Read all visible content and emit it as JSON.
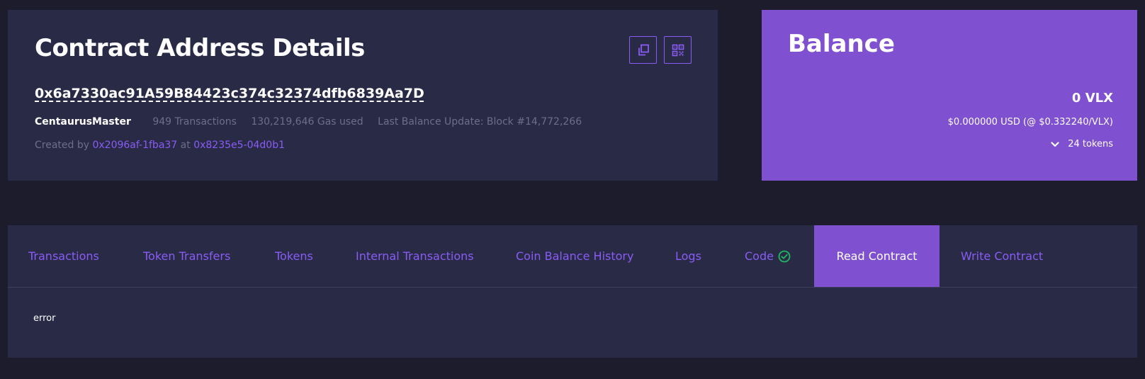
{
  "details": {
    "title": "Contract Address Details",
    "address": "0x6a7330ac91A59B84423c374c32374dfb6839Aa7D",
    "name": "CentaurusMaster",
    "transactions": "949 Transactions",
    "gas_used": "130,219,646 Gas used",
    "last_balance_update": "Last Balance Update: Block #14,772,266",
    "created_by_label": "Created by",
    "creator": "0x2096af-1fba37",
    "at_label": "at",
    "creation_tx": "0x8235e5-04d0b1",
    "copy_icon": "copy-icon",
    "qr_icon": "qr-code-icon"
  },
  "balance": {
    "title": "Balance",
    "amount": "0 VLX",
    "usd": "$0.000000 USD (@ $0.332240/VLX)",
    "tokens": "24 tokens",
    "toggle_icon": "chevron-down-icon"
  },
  "tabs": [
    {
      "label": "Transactions"
    },
    {
      "label": "Token Transfers"
    },
    {
      "label": "Tokens"
    },
    {
      "label": "Internal Transactions"
    },
    {
      "label": "Coin Balance History"
    },
    {
      "label": "Logs"
    },
    {
      "label": "Code",
      "icon": "check-circle-icon"
    },
    {
      "label": "Read Contract",
      "active": true
    },
    {
      "label": "Write Contract"
    }
  ],
  "content": {
    "message": "error"
  },
  "colors": {
    "page_bg": "#1c1c2c",
    "card_bg": "#282a46",
    "accent": "#7f50cf",
    "link": "#8a5cf5",
    "muted": "#6d6e8a",
    "success": "#20b760"
  }
}
